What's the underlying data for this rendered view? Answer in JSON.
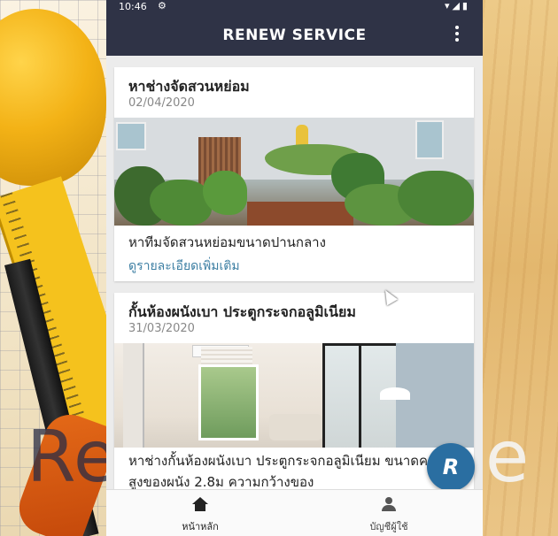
{
  "app": {
    "title": "RENEW SERVICE"
  },
  "statusbar": {
    "time": "10:46"
  },
  "cards": [
    {
      "title": "หาช่างจัดสวนหย่อม",
      "date": "02/04/2020",
      "description": "หาทีมจัดสวนหย่อมขนาดปานกลาง",
      "more_link": "ดูรายละเอียดเพิ่มเติม"
    },
    {
      "title": "กั้นห้องผนังเบา ประตูกระจกอลูมิเนียม",
      "date": "31/03/2020",
      "description": "หาช่างกั้นห้องผนังเบา ประตูกระจกอลูมิเนียม ขนาดความสูงของผนัง 2.8ม ความกว้างของ"
    }
  ],
  "fab": {
    "label": "R"
  },
  "bottom_nav": [
    {
      "label": "หน้าหลัก",
      "icon": "home-icon"
    },
    {
      "label": "บัญชีผู้ใช้",
      "icon": "account-icon"
    }
  ],
  "background_text": {
    "left": "Re",
    "right": "e"
  },
  "colors": {
    "appbar": "#2f3346",
    "link": "#3d7fa3",
    "fab": "#2a6ea1"
  }
}
